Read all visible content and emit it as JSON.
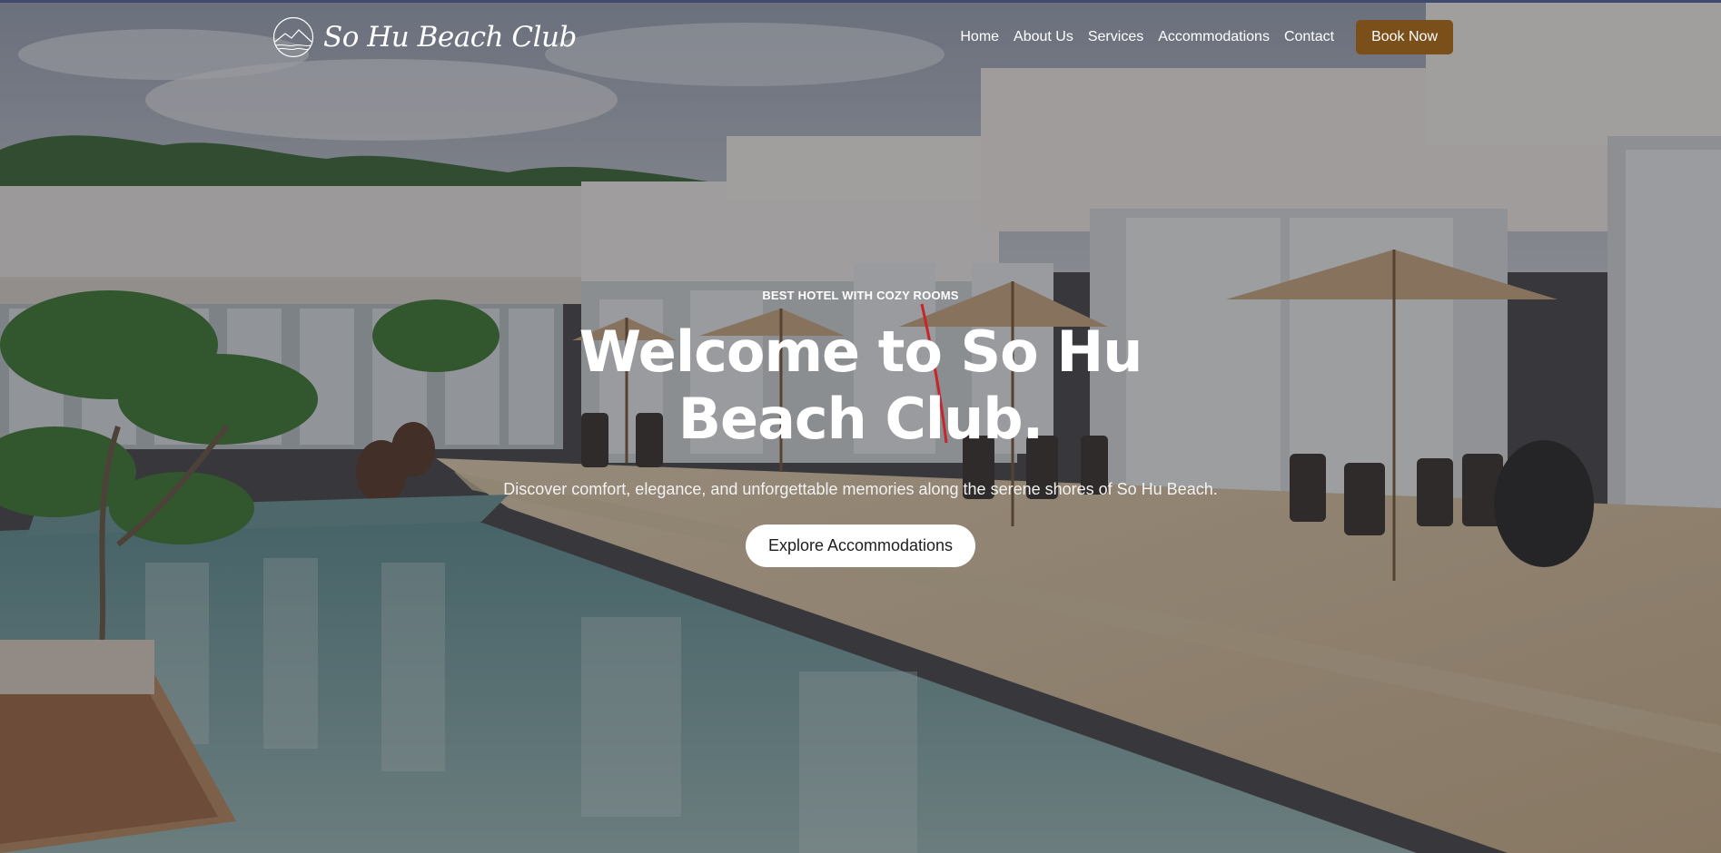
{
  "brand": {
    "name": "So Hu Beach Club",
    "logo_icon": "mountain-sea-circle-logo"
  },
  "nav": {
    "items": [
      {
        "label": "Home"
      },
      {
        "label": "About Us"
      },
      {
        "label": "Services"
      },
      {
        "label": "Accommodations"
      },
      {
        "label": "Contact"
      }
    ],
    "cta_label": "Book Now"
  },
  "hero": {
    "eyebrow": "BEST HOTEL WITH COZY ROOMS",
    "title": "Welcome to So Hu Beach Club.",
    "subtitle": "Discover comfort, elegance, and unforgettable memories along the serene shores of So Hu Beach.",
    "button_label": "Explore Accommodations"
  },
  "colors": {
    "cta_background": "#7a4f19",
    "overlay": "#1c1c22",
    "button_background": "#ffffff",
    "top_border": "#3f4a6e"
  }
}
